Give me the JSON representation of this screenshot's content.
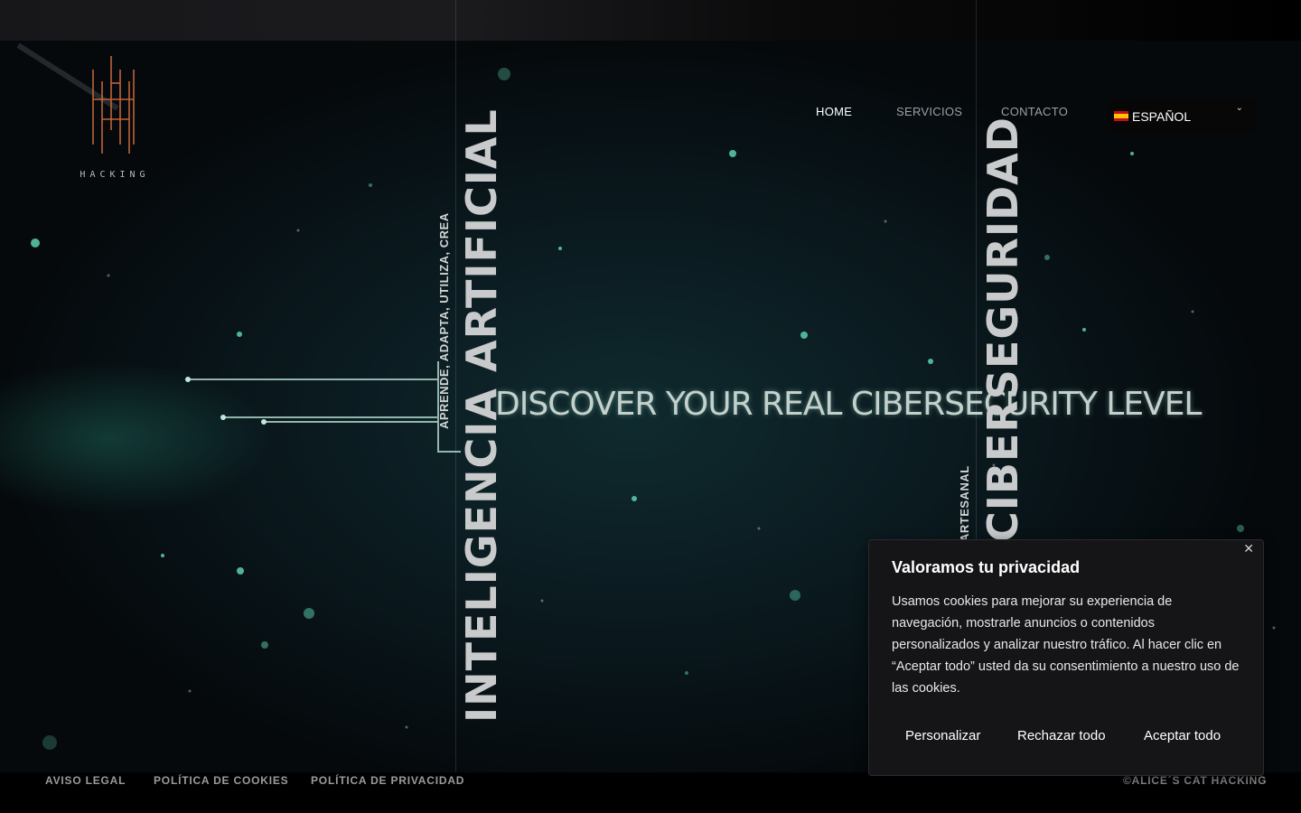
{
  "logo": {
    "label": "HACKING"
  },
  "nav": {
    "items": [
      {
        "label": "HOME",
        "active": true
      },
      {
        "label": "SERVICIOS",
        "active": false
      },
      {
        "label": "CONTACTO",
        "active": false
      }
    ],
    "language": {
      "label": "ESPAÑOL",
      "flag_icon": "spain-flag-icon"
    }
  },
  "hero": {
    "headline": "DISCOVER YOUR REAL CIBERSECURITY LEVEL",
    "column_ai": {
      "title": "INTELIGENCIA ARTIFICIAL",
      "subtitle": "APRENDE, ADAPTA, UTILIZA, CREA"
    },
    "column_security": {
      "title": "CIBERSEGURIDAD",
      "subtitle": "ARTESANAL"
    }
  },
  "footer": {
    "links": [
      "AVISO LEGAL",
      "POLÍTICA DE COOKIES",
      "POLÍTICA DE PRIVACIDAD"
    ],
    "copyright": "©ALICE´S CAT HACKING"
  },
  "cookie_banner": {
    "title": "Valoramos tu privacidad",
    "text": "Usamos cookies para mejorar su experiencia de navegación, mostrarle anuncios o contenidos personalizados y analizar nuestro tráfico. Al hacer clic en “Aceptar todo” usted da su consentimiento a nuestro uso de las cookies.",
    "buttons": {
      "customize": "Personalizar",
      "reject": "Rechazar todo",
      "accept": "Aceptar todo"
    }
  },
  "colors": {
    "logo_accent": "#c0643a",
    "modal_bg": "#151517",
    "hero_teal": "#0f2a2e"
  }
}
